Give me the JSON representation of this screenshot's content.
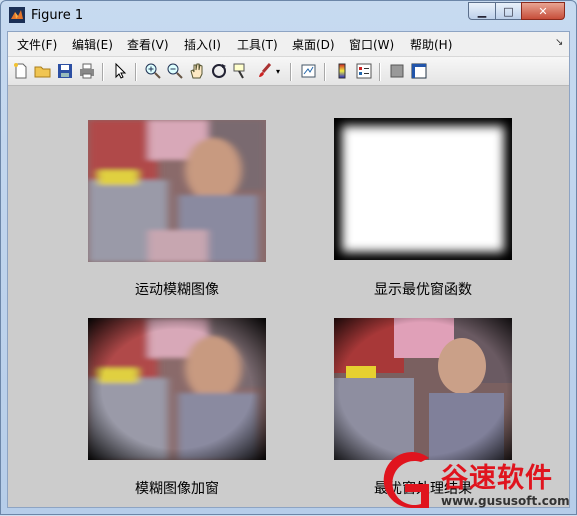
{
  "window": {
    "title": "Figure 1"
  },
  "menu": {
    "items": [
      {
        "name": "menu-file",
        "label": "文件(F)"
      },
      {
        "name": "menu-edit",
        "label": "编辑(E)"
      },
      {
        "name": "menu-view",
        "label": "查看(V)"
      },
      {
        "name": "menu-insert",
        "label": "插入(I)"
      },
      {
        "name": "menu-tools",
        "label": "工具(T)"
      },
      {
        "name": "menu-desktop",
        "label": "桌面(D)"
      },
      {
        "name": "menu-window",
        "label": "窗口(W)"
      },
      {
        "name": "menu-help",
        "label": "帮助(H)"
      }
    ]
  },
  "toolbar": {
    "icons": [
      "new-figure-icon",
      "open-file-icon",
      "save-icon",
      "print-icon",
      "pointer-icon",
      "zoom-in-icon",
      "zoom-out-icon",
      "pan-hand-icon",
      "rotate-3d-icon",
      "data-cursor-icon",
      "brush-icon",
      "link-plot-icon",
      "colorbar-icon",
      "legend-icon",
      "hide-plot-tools-icon",
      "show-plot-tools-icon"
    ]
  },
  "subplots": [
    {
      "caption": "运动模糊图像"
    },
    {
      "caption": "显示最优窗函数"
    },
    {
      "caption": "模糊图像加窗"
    },
    {
      "caption": "最优窗处理结果"
    }
  ],
  "watermark": {
    "brand": "谷速软件",
    "url": "www.gususoft.com"
  },
  "colors": {
    "titlebar": "#c7daf0",
    "canvas": "#cccccc",
    "close_button": "#c74e3a",
    "brand_red": "#e0141e"
  }
}
